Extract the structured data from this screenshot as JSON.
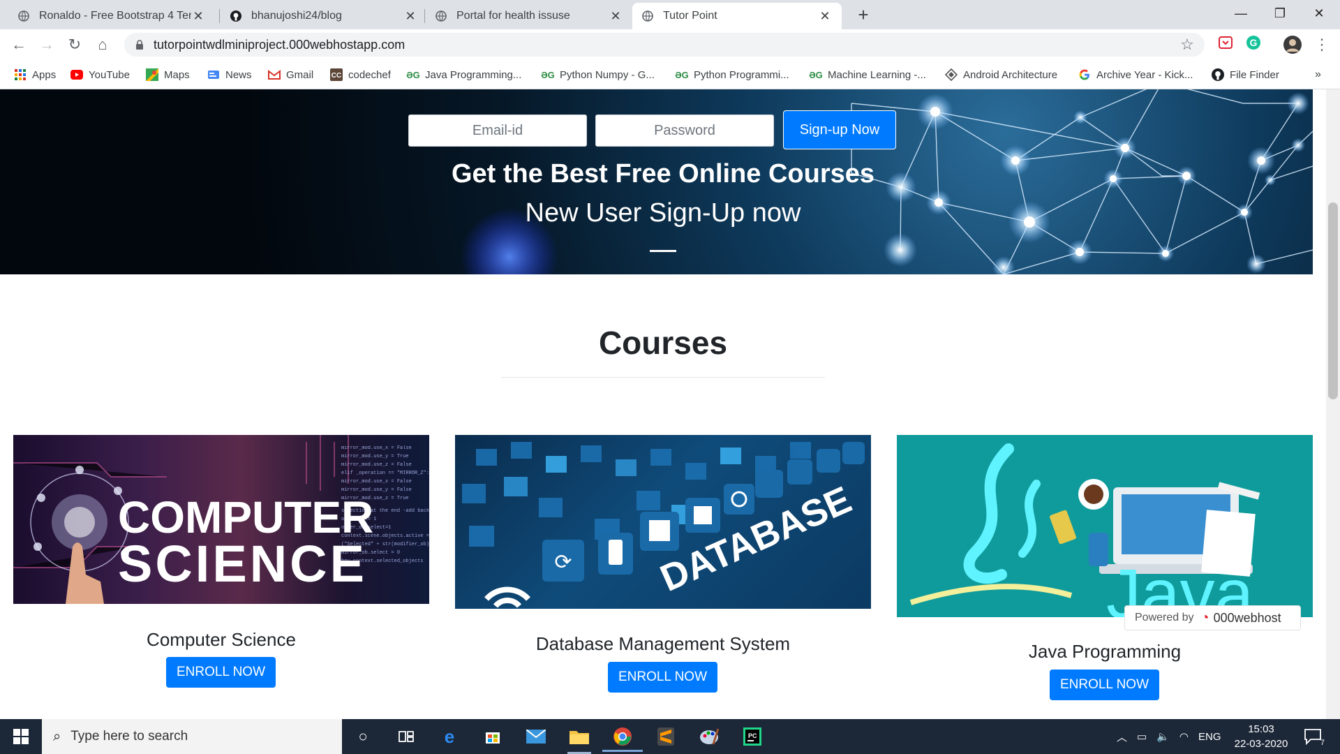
{
  "browser": {
    "tabs": [
      {
        "title": "Ronaldo - Free Bootstrap 4 Temp",
        "active": false
      },
      {
        "title": "bhanujoshi24/blog",
        "active": false
      },
      {
        "title": "Portal for health issuse",
        "active": false
      },
      {
        "title": "Tutor Point",
        "active": true
      }
    ],
    "new_tab_label": "+",
    "url": "tutorpointwdlminiproject.000webhostapp.com",
    "bookmarks": [
      {
        "label": "Apps",
        "icon": "apps-grid-icon"
      },
      {
        "label": "YouTube",
        "icon": "youtube-icon"
      },
      {
        "label": "Maps",
        "icon": "maps-icon"
      },
      {
        "label": "News",
        "icon": "news-icon"
      },
      {
        "label": "Gmail",
        "icon": "gmail-icon"
      },
      {
        "label": "codechef",
        "icon": "codechef-icon"
      },
      {
        "label": "Java Programming...",
        "icon": "geeksforgeeks-icon"
      },
      {
        "label": "Python Numpy - G...",
        "icon": "geeksforgeeks-icon"
      },
      {
        "label": "Python Programmi...",
        "icon": "geeksforgeeks-icon"
      },
      {
        "label": "Machine Learning -...",
        "icon": "geeksforgeeks-icon"
      },
      {
        "label": "Android Architecture",
        "icon": "android-architecture-icon"
      },
      {
        "label": "Archive Year - Kick...",
        "icon": "google-icon"
      },
      {
        "label": "File Finder",
        "icon": "github-icon"
      }
    ],
    "bookmarks_overflow": "»"
  },
  "hero": {
    "email_placeholder": "Email-id",
    "password_placeholder": "Password",
    "signup_label": "Sign-up Now",
    "headline": "Get the Best Free Online Courses",
    "subheadline": "New User Sign-Up now"
  },
  "courses": {
    "heading": "Courses",
    "items": [
      {
        "image_text_1": "COMPUTER",
        "image_text_2": "SCIENCE",
        "title": "Computer Science",
        "button": "ENROLL NOW"
      },
      {
        "image_text_1": "DATABASE",
        "title": "Database Management System",
        "button": "ENROLL NOW"
      },
      {
        "image_text_1": "Java",
        "title": "Java Programming",
        "button": "ENROLL NOW"
      }
    ]
  },
  "powered": {
    "prefix": "Powered by",
    "brand": "000webhost"
  },
  "taskbar": {
    "search_placeholder": "Type here to search",
    "language": "ENG",
    "time": "15:03",
    "date": "22-03-2020",
    "notification_count": "7"
  }
}
